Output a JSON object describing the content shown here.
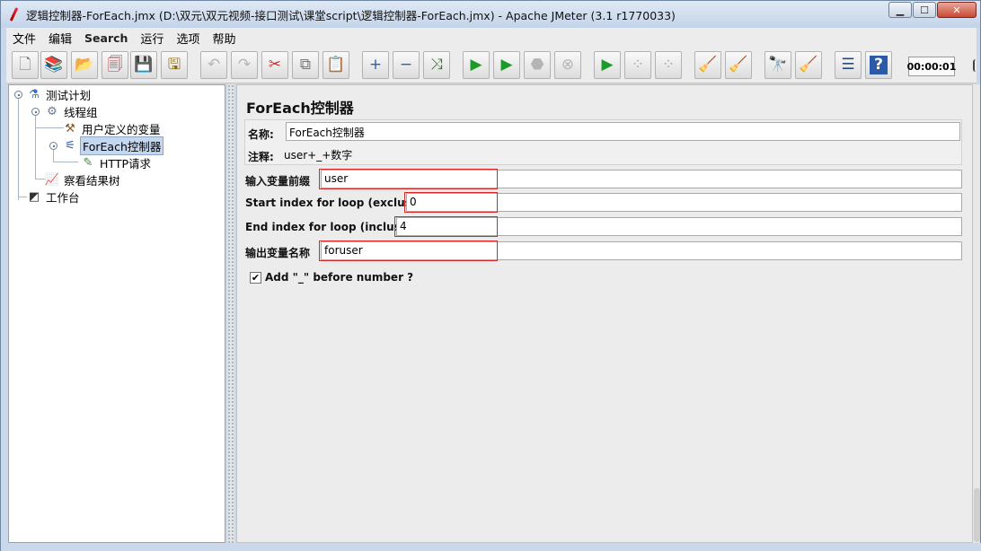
{
  "window": {
    "title": "逻辑控制器-ForEach.jmx (D:\\双元\\双元视频-接口测试\\课堂script\\逻辑控制器-ForEach.jmx) - Apache JMeter (3.1 r1770033)",
    "controls": {
      "minimize": "▁",
      "maximize": "☐",
      "close": "✕"
    }
  },
  "menu": [
    "文件",
    "编辑",
    "Search",
    "运行",
    "选项",
    "帮助"
  ],
  "toolbar": {
    "buttons": [
      {
        "name": "new-icon",
        "glyph": "🗋"
      },
      {
        "name": "templates-icon",
        "glyph": "📚"
      },
      {
        "name": "open-icon",
        "glyph": "📂"
      },
      {
        "name": "close-file-icon",
        "glyph": "🗐"
      },
      {
        "name": "save-icon",
        "glyph": "💾"
      },
      {
        "name": "save-screenshot-icon",
        "glyph": "🖫"
      },
      {
        "name": "undo-icon",
        "glyph": "↶"
      },
      {
        "name": "redo-icon",
        "glyph": "↷"
      },
      {
        "name": "cut-icon",
        "glyph": "✂"
      },
      {
        "name": "copy-icon",
        "glyph": "⧉"
      },
      {
        "name": "paste-icon",
        "glyph": "📋"
      },
      {
        "name": "expand-icon",
        "glyph": "+"
      },
      {
        "name": "collapse-icon",
        "glyph": "−"
      },
      {
        "name": "toggle-icon",
        "glyph": "⤨"
      },
      {
        "name": "start-icon",
        "glyph": "▶"
      },
      {
        "name": "start-no-pause-icon",
        "glyph": "▶"
      },
      {
        "name": "stop-icon",
        "glyph": "⬣"
      },
      {
        "name": "shutdown-icon",
        "glyph": "⊗"
      },
      {
        "name": "remote-start-icon",
        "glyph": "▶"
      },
      {
        "name": "remote-stop-icon",
        "glyph": "⁘"
      },
      {
        "name": "remote-shutdown-icon",
        "glyph": "⁘"
      },
      {
        "name": "clear-icon",
        "glyph": "🧹"
      },
      {
        "name": "clear-all-icon",
        "glyph": "🧹"
      },
      {
        "name": "search-icon",
        "glyph": "🔭"
      },
      {
        "name": "reset-search-icon",
        "glyph": "🧹"
      },
      {
        "name": "function-helper-icon",
        "glyph": "☰"
      },
      {
        "name": "help-icon",
        "glyph": "?"
      }
    ],
    "timer": "00:00:01"
  },
  "tree": {
    "nodes": [
      {
        "label": "测试计划",
        "icon": "flask-icon",
        "glyph": "⚗"
      },
      {
        "label": "线程组",
        "icon": "gear-icon",
        "glyph": "⚙"
      },
      {
        "label": "用户定义的变量",
        "icon": "tools-icon",
        "glyph": "⚒"
      },
      {
        "label": "ForEach控制器",
        "icon": "controller-icon",
        "glyph": "⚟"
      },
      {
        "label": "HTTP请求",
        "icon": "pipette-icon",
        "glyph": "✎"
      },
      {
        "label": "察看结果树",
        "icon": "chart-icon",
        "glyph": "📈"
      },
      {
        "label": "工作台",
        "icon": "workbench-icon",
        "glyph": "◩"
      }
    ]
  },
  "panel": {
    "title": "ForEach控制器",
    "name_label": "名称:",
    "name_value": "ForEach控制器",
    "comment_label": "注释:",
    "comment_value": "user+_+数字",
    "input_prefix_label": "输入变量前缀",
    "input_prefix_value": "user",
    "start_label": "Start index for loop (exclusive)",
    "start_value": "0",
    "end_label": "End index for loop (inclusive)",
    "end_value": "4",
    "output_label": "输出变量名称",
    "output_value": "foruser",
    "add_underscore_label": "Add \"_\" before number ?",
    "add_underscore_checked": "✔"
  },
  "colors": {
    "highlight": "#d42a2a",
    "selection": "#c5d7ee"
  }
}
